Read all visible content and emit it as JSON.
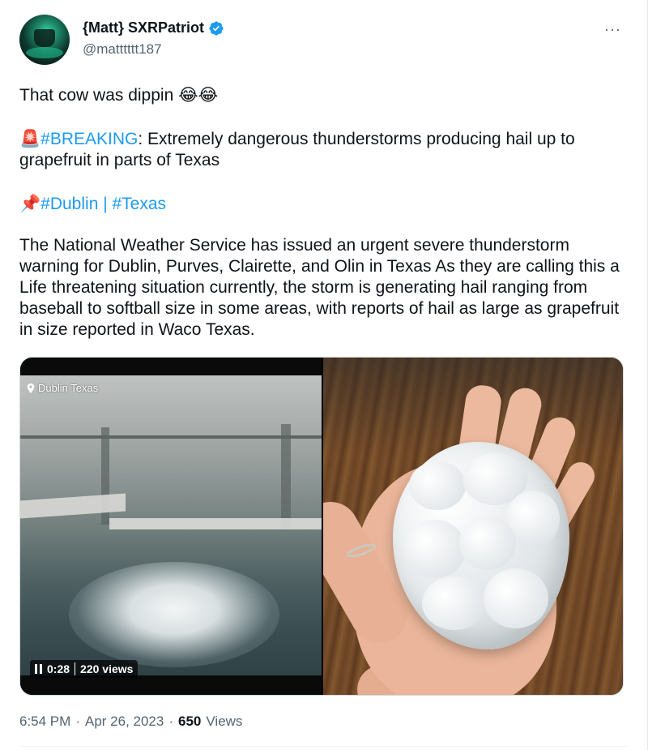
{
  "author": {
    "display_name": "{Matt} SXRPatriot",
    "handle": "@matttttt187",
    "verified": true
  },
  "tweet": {
    "line1": "That cow was dippin",
    "line1_emoji": "😂😂",
    "breaking_emoji": "🚨",
    "breaking_tag": "#BREAKING",
    "breaking_text": ": Extremely dangerous thunderstorms producing hail up to grapefruit in parts of Texas",
    "pin_emoji": "📌",
    "tag_dublin": "#Dublin",
    "tag_separator": " | ",
    "tag_texas": "#Texas",
    "body": "The National Weather Service has issued an urgent severe thunderstorm warning for Dublin, Purves, Clairette, and Olin in Texas As they are calling this a Life threatening situation currently, the storm is generating hail ranging from baseball to softball size in some areas, with reports of hail as large as grapefruit in size reported in Waco Texas."
  },
  "media": {
    "video_location": "Dublin Texas",
    "video_time": "0:28",
    "video_views": "220 views"
  },
  "meta": {
    "time": "6:54 PM",
    "dot": "·",
    "date": "Apr 26, 2023",
    "views_count": "650",
    "views_label": "Views"
  },
  "more_icon": "···",
  "colors": {
    "link": "#1d9bf0",
    "verified": "#1d9bf0",
    "secondary_text": "#536471"
  }
}
